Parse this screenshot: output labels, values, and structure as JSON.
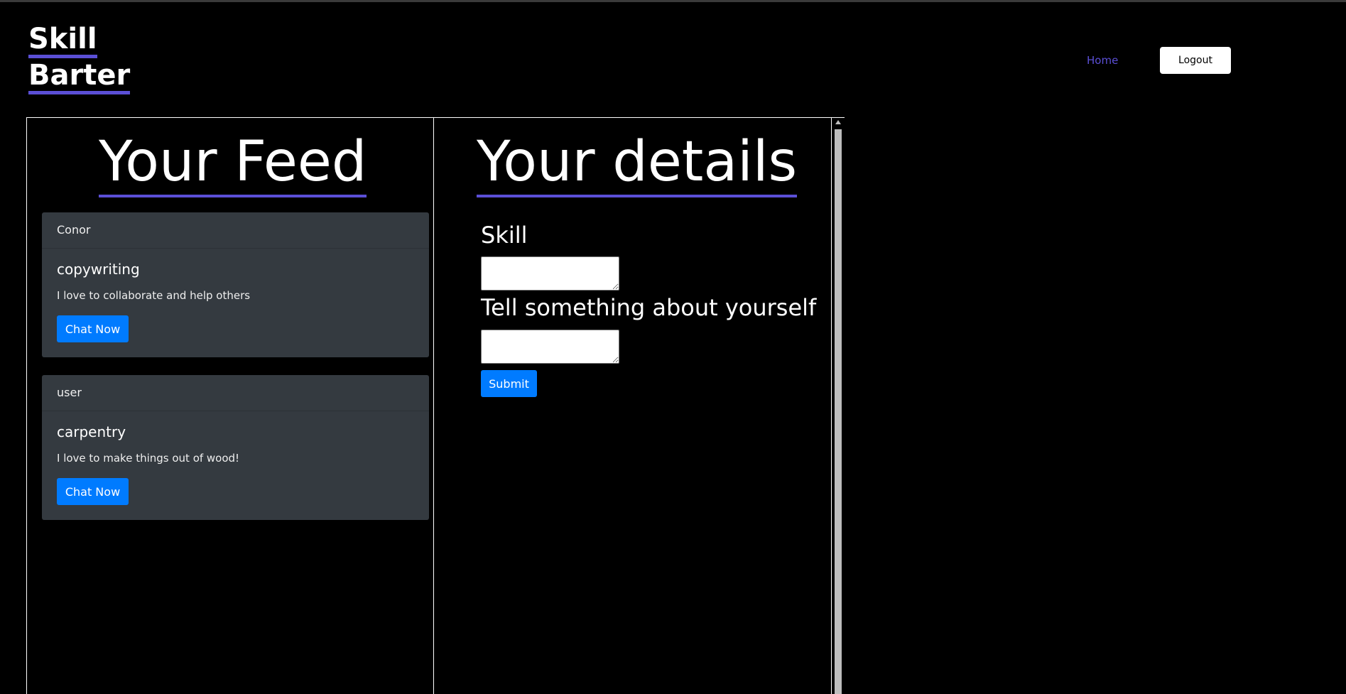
{
  "brand": {
    "line1": "Skill",
    "line2": "Barter",
    "accent_color": "#5b4fd6"
  },
  "nav": {
    "home_label": "Home",
    "logout_label": "Logout"
  },
  "feed": {
    "title": "Your Feed",
    "cards": [
      {
        "user": "Conor",
        "skill": "copywriting",
        "description": "I love to collaborate and help others",
        "button_label": "Chat Now"
      },
      {
        "user": "user",
        "skill": "carpentry",
        "description": "I love to make things out of wood!",
        "button_label": "Chat Now"
      }
    ]
  },
  "details": {
    "title": "Your details",
    "skill_label": "Skill",
    "skill_value": "",
    "about_label": "Tell something about yourself",
    "about_value": "",
    "submit_label": "Submit"
  },
  "colors": {
    "primary_button": "#007bff",
    "card_bg": "#343a40",
    "background": "#000000"
  }
}
